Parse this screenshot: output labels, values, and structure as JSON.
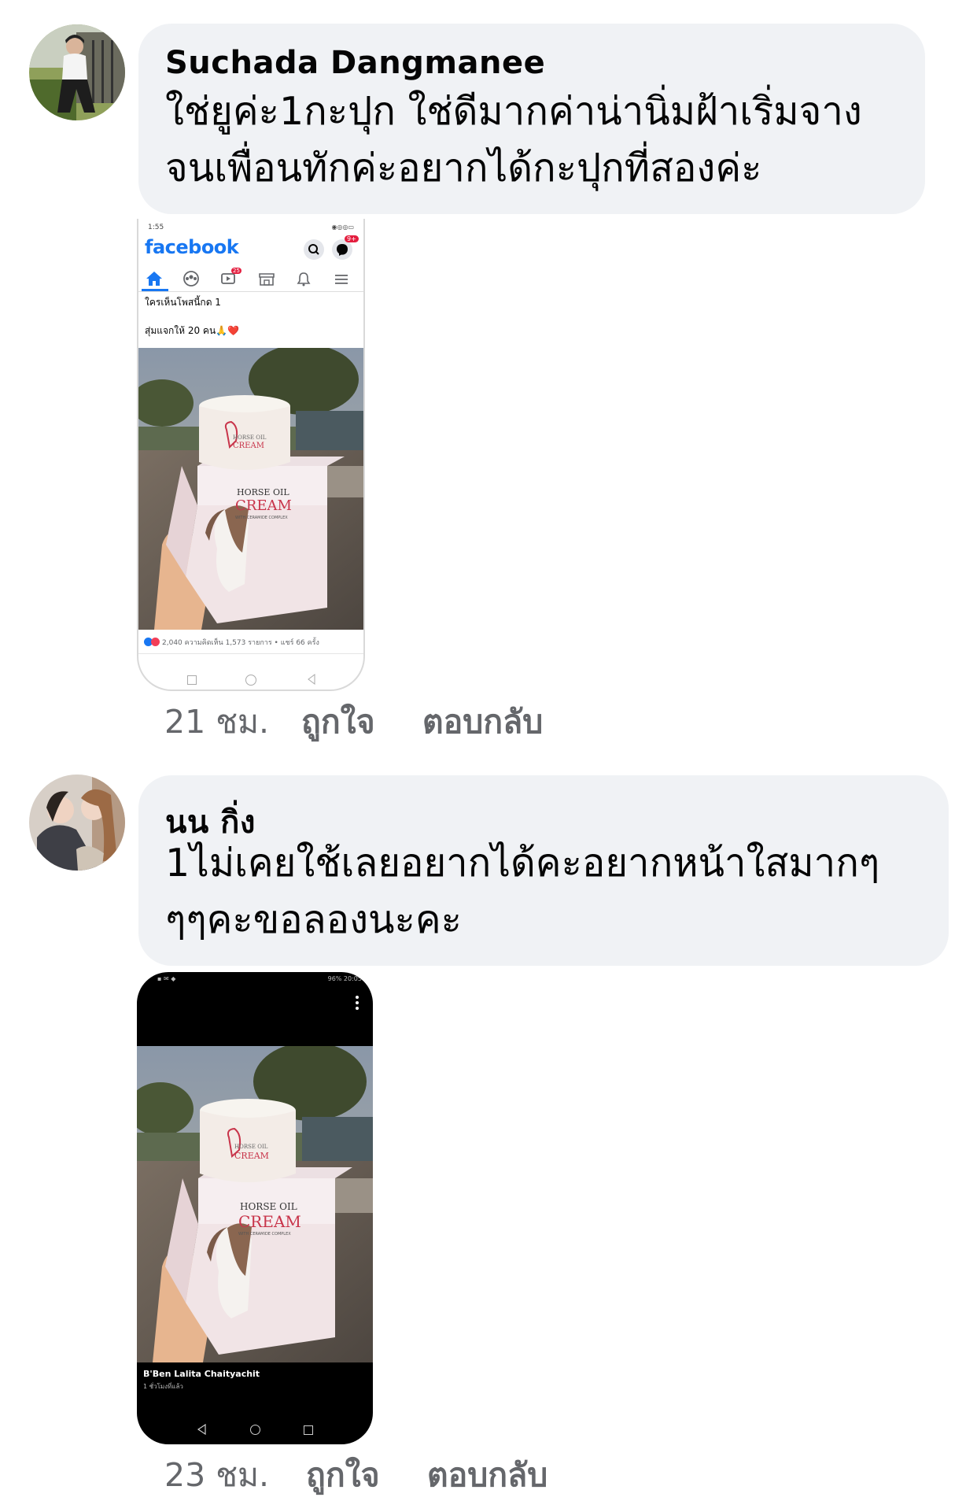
{
  "comments": [
    {
      "author": "Suchada Dangmanee",
      "text": "ใช่ยูค่ะ1กะปุก ใช่ดีมากค่าน่านิ่มฝ้าเริ่มจาง\nจนเพื่อนทักค่ะอยากได้กะปุกที่สองค่ะ",
      "time": "21 ชม.",
      "like": "ถูกใจ",
      "reply": "ตอบกลับ",
      "attachment": {
        "status_time": "1:55",
        "app_name": "facebook",
        "notification_badge": "9+",
        "watch_badge": "25",
        "post_line1": "ใครเห็นโพสนี้กด 1",
        "post_line2": "สุ่มแจกให้ 20 คน🙏❤️",
        "product_brand": "HORSE OIL",
        "product_name": "CREAM",
        "product_sub": "WITH CERAMIDE COMPLEX",
        "stats": "2,040 ความคิดเห็น 1,573 รายการ • แชร์ 66 ครั้ง"
      }
    },
    {
      "author": "นน กิ่ง",
      "text": "1ไม่เคยใช้เลยอยากได้คะอยากหน้าใสมากๆ\nๆๆคะขอลองนะคะ",
      "time": "23 ชม.",
      "like": "ถูกใจ",
      "reply": "ตอบกลับ",
      "attachment": {
        "status_right": "96%  20:05",
        "product_brand": "HORSE OIL",
        "product_name": "CREAM",
        "product_sub": "WITH CERAMIDE COMPLEX",
        "poster_name": "B'Ben Lalita Chaityachit",
        "poster_time": "1 ชั่วโมงที่แล้ว"
      }
    }
  ],
  "colors": {
    "bubble": "#f0f2f5",
    "meta_text": "#65676b",
    "facebook_blue": "#1877f2",
    "cream_red": "#c8344a"
  }
}
